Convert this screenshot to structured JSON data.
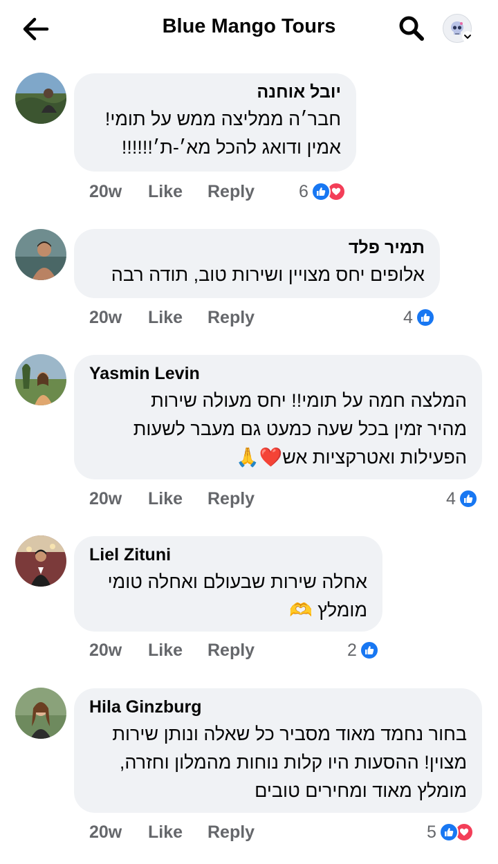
{
  "header": {
    "title": "Blue Mango Tours",
    "back_icon": "arrow-left-icon",
    "search_icon": "search-icon"
  },
  "comments": [
    {
      "author": "יובל אוחנה",
      "lines": [
        "חבר׳ה ממליצה ממש על תומי!",
        "אמין ודואג להכל מא׳-ת׳!!!!!!"
      ],
      "time": "20w",
      "like": "Like",
      "reply": "Reply",
      "reaction_count": "6",
      "reactions": [
        "like",
        "love"
      ]
    },
    {
      "author": "תמיר פלד",
      "lines": [
        "אלופים יחס מצויין ושירות טוב, תודה רבה"
      ],
      "time": "20w",
      "like": "Like",
      "reply": "Reply",
      "reaction_count": "4",
      "reactions": [
        "like"
      ]
    },
    {
      "author": "Yasmin Levin",
      "lines": [
        "המלצה חמה על תומי!! יחס מעולה שירות",
        "מהיר זמין בכל שעה כמעט גם מעבר לשעות",
        "הפעילות ואטרקציות אש❤️🙏"
      ],
      "time": "20w",
      "like": "Like",
      "reply": "Reply",
      "reaction_count": "4",
      "reactions": [
        "like"
      ]
    },
    {
      "author": "Liel Zituni",
      "lines": [
        "אחלה שירות שבעולם ואחלה טומי",
        "מומלץ 🫶"
      ],
      "time": "20w",
      "like": "Like",
      "reply": "Reply",
      "reaction_count": "2",
      "reactions": [
        "like"
      ]
    },
    {
      "author": "Hila Ginzburg",
      "lines": [
        "בחור נחמד מאוד מסביר כל שאלה ונותן שירות",
        "מצוין! ההסעות היו קלות נוחות מהמלון וחזרה,",
        "מומלץ מאוד ומחירים טובים"
      ],
      "time": "20w",
      "like": "Like",
      "reply": "Reply",
      "reaction_count": "5",
      "reactions": [
        "like",
        "love"
      ]
    }
  ],
  "colors": {
    "like_blue": "#1877f2",
    "love_red": "#f33e58",
    "bubble_bg": "#f0f2f5",
    "meta_gray": "#65676b"
  }
}
